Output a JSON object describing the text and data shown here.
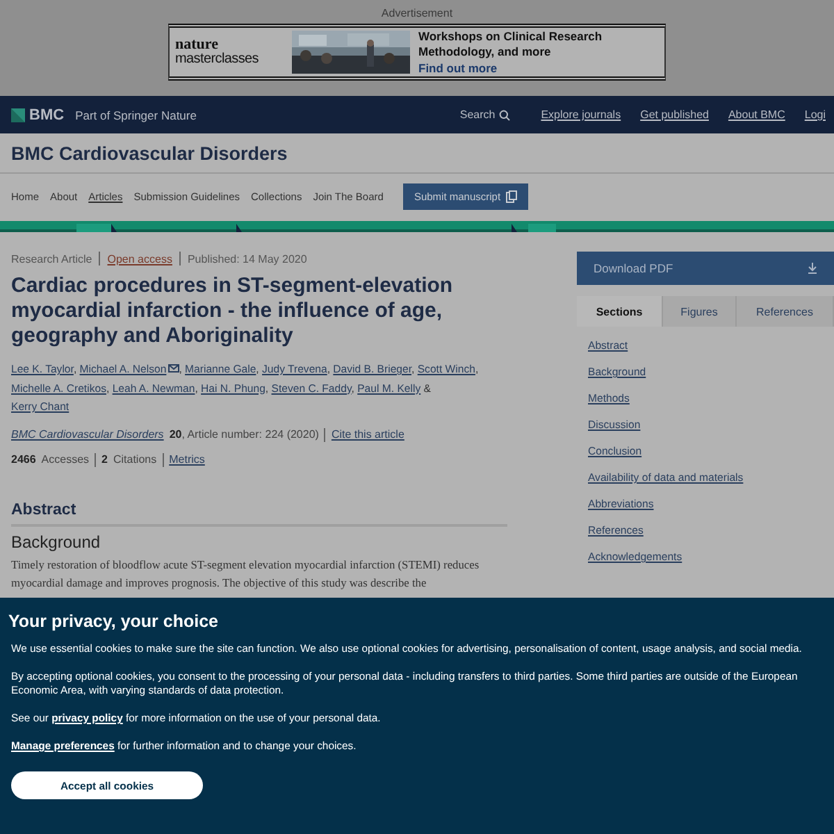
{
  "advert": {
    "label": "Advertisement",
    "brand_top": "nature",
    "brand_bottom": "masterclasses",
    "headline": "Workshops on Clinical Research Methodology, and more",
    "link": "Find out more"
  },
  "topbar": {
    "brand": "BMC",
    "tagline": "Part of Springer Nature",
    "search": "Search",
    "links": [
      "Explore journals",
      "Get published",
      "About BMC",
      "Logi"
    ]
  },
  "journal": {
    "title": "BMC Cardiovascular Disorders"
  },
  "nav": {
    "items": [
      {
        "label": "Home",
        "selected": false
      },
      {
        "label": "About",
        "selected": false
      },
      {
        "label": "Articles",
        "selected": true
      },
      {
        "label": "Submission Guidelines",
        "selected": false
      },
      {
        "label": "Collections",
        "selected": false
      },
      {
        "label": "Join The Board",
        "selected": false
      }
    ],
    "button": "Submit manuscript"
  },
  "article": {
    "type": "Research Article",
    "access": "Open access",
    "published": "Published: 14 May 2020",
    "title": "Cardiac procedures in ST-segment-elevation myocardial infarction - the influence of age, geography and Aboriginality",
    "authors": [
      {
        "name": "Lee K. Taylor",
        "email": false,
        "separator": ","
      },
      {
        "name": "Michael A. Nelson",
        "email": true,
        "separator": ","
      },
      {
        "name": "Marianne Gale",
        "email": false,
        "separator": ","
      },
      {
        "name": "Judy Trevena",
        "email": false,
        "separator": ","
      },
      {
        "name": "David B. Brieger",
        "email": false,
        "separator": ","
      },
      {
        "name": "Scott Winch",
        "email": false,
        "separator": ","
      },
      {
        "name": "Michelle A. Cretikos",
        "email": false,
        "separator": ","
      },
      {
        "name": "Leah A. Newman",
        "email": false,
        "separator": ","
      },
      {
        "name": "Hai N. Phung",
        "email": false,
        "separator": ","
      },
      {
        "name": "Steven C. Faddy",
        "email": false,
        "separator": ","
      },
      {
        "name": "Paul M. Kelly",
        "email": false,
        "separator": "&"
      },
      {
        "name": "Kerry Chant",
        "email": false
      }
    ],
    "journal": "BMC Cardiovascular Disorders",
    "volume": "20",
    "article_number": ", Article number: 224 (2020)",
    "cite": "Cite this article",
    "accesses": "2466",
    "accesses_label": "Accesses",
    "citations": "2",
    "citations_label": "Citations",
    "metrics": "Metrics",
    "abstract_heading": "Abstract",
    "section_heading": "Background",
    "abstract_text": "Timely restoration of bloodflow acute ST-segment elevation myocardial infarction (STEMI) reduces myocardial damage and improves prognosis. The objective of this study was describe the"
  },
  "sidebar": {
    "download": "Download PDF",
    "tabs": [
      {
        "label": "Sections",
        "selected": true
      },
      {
        "label": "Figures",
        "selected": false
      },
      {
        "label": "References",
        "selected": false
      }
    ],
    "links": [
      "Abstract",
      "Background",
      "Methods",
      "Discussion",
      "Conclusion",
      "Availability of data and materials",
      "Abbreviations",
      "References",
      "Acknowledgements"
    ]
  },
  "cookie_banner": {
    "title": "Your privacy, your choice",
    "paragraph_1": "We use essential cookies to make sure the site can function. We also use optional cookies for advertising, personalisation of content, usage analysis, and social media.",
    "paragraph_2": "By accepting optional cookies, you consent to the processing of your personal data - including transfers to third parties. Some third parties are outside of the European Economic Area, with varying standards of data protection.",
    "paragraph_3_before": "See our",
    "privacy_link": "privacy policy",
    "paragraph_3_after": "for more information on the use of your personal data.",
    "manage_link": "Manage preferences",
    "manage_text": "for further information and to change your choices.",
    "accept": "Accept all cookies"
  }
}
